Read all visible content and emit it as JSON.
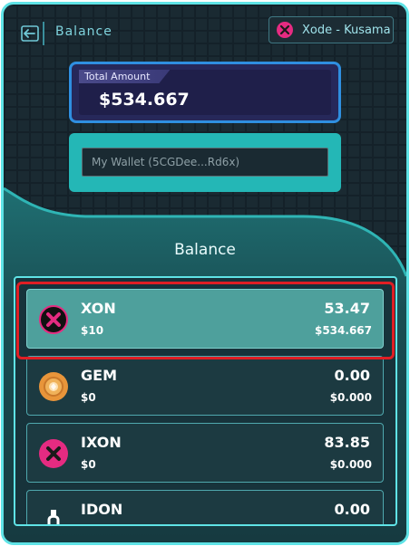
{
  "header": {
    "title": "Balance",
    "back_icon": "back-arrow-icon",
    "network": {
      "label": "Xode - Kusama",
      "icon": "xode-logo-icon",
      "color": "#e52b81"
    }
  },
  "total": {
    "label": "Total Amount",
    "value": "$534.667"
  },
  "wallet": {
    "text": "My Wallet  (5CGDee...Rd6x)"
  },
  "balance_panel": {
    "title": "Balance"
  },
  "tokens": [
    {
      "name": "XON",
      "usd": "$10",
      "amount": "53.47",
      "value": "$534.667",
      "icon": "xon-logo-icon",
      "selected": true
    },
    {
      "name": "GEM",
      "usd": "$0",
      "amount": "0.00",
      "value": "$0.000",
      "icon": "gem-coin-icon",
      "selected": false
    },
    {
      "name": "IXON",
      "usd": "$0",
      "amount": "83.85",
      "value": "$0.000",
      "icon": "ixon-logo-icon",
      "selected": false
    },
    {
      "name": "IDON",
      "usd": "",
      "amount": "0.00",
      "value": "",
      "icon": "idon-logo-icon",
      "selected": false
    }
  ],
  "colors": {
    "accent": "#5fe3e6",
    "teal": "#24b7b6",
    "total_border": "#2f8fe0",
    "highlight": "#e01e24"
  }
}
